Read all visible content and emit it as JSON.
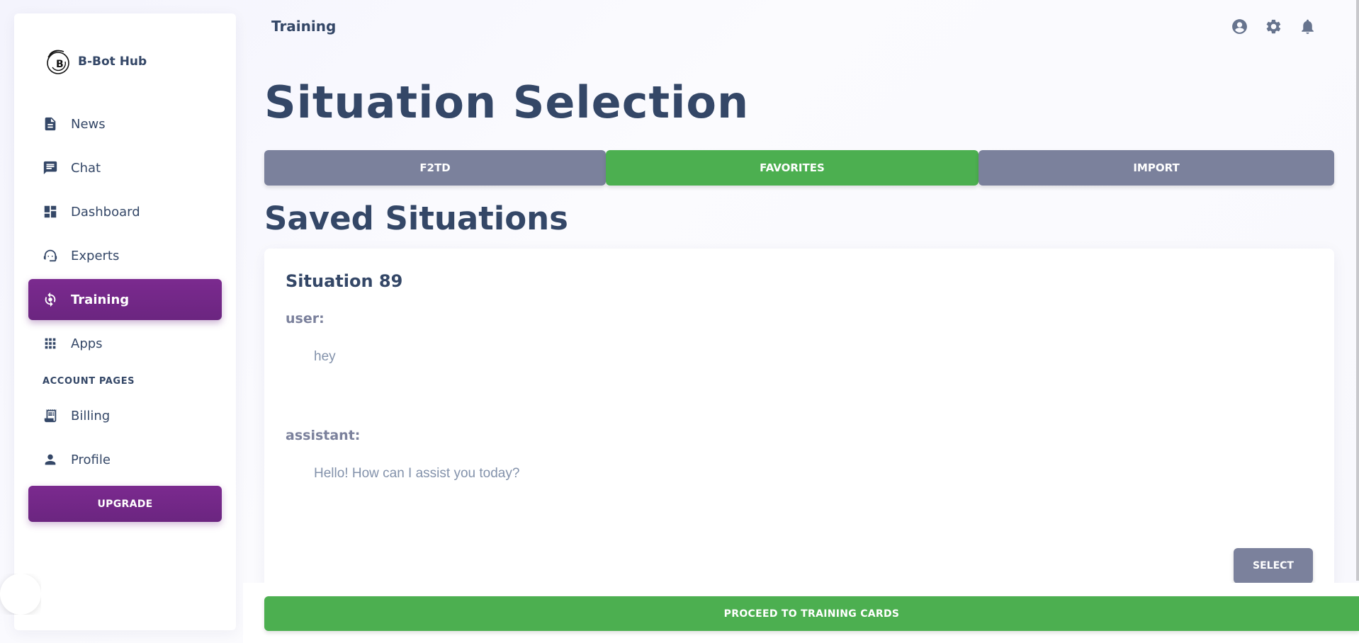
{
  "brand": {
    "name": "B-Bot Hub",
    "logo_icon": "b-bot-swirl-logo"
  },
  "sidebar": {
    "items": [
      {
        "label": "News",
        "icon": "document-icon"
      },
      {
        "label": "Chat",
        "icon": "chat-icon"
      },
      {
        "label": "Dashboard",
        "icon": "dashboard-icon"
      },
      {
        "label": "Experts",
        "icon": "support-agent-icon"
      },
      {
        "label": "Training",
        "icon": "training-icon",
        "active": true
      },
      {
        "label": "Apps",
        "icon": "apps-grid-icon"
      }
    ],
    "section_title": "ACCOUNT PAGES",
    "account_items": [
      {
        "label": "Billing",
        "icon": "receipt-icon"
      },
      {
        "label": "Profile",
        "icon": "person-icon"
      }
    ],
    "upgrade_label": "UPGRADE"
  },
  "header": {
    "breadcrumb": "Training",
    "icons": [
      "account-circle-icon",
      "settings-icon",
      "notifications-icon"
    ]
  },
  "main": {
    "title": "Situation Selection",
    "tabs": [
      {
        "label": "F2TD",
        "active": false
      },
      {
        "label": "FAVORITES",
        "active": true
      },
      {
        "label": "IMPORT",
        "active": false
      }
    ],
    "section_title": "Saved Situations",
    "card": {
      "title": "Situation 89",
      "messages": [
        {
          "role": "user:",
          "text": "hey"
        },
        {
          "role": "assistant:",
          "text": "Hello! How can I assist you today?"
        }
      ],
      "select_label": "SELECT"
    },
    "proceed_label": "PROCEED TO TRAINING CARDS"
  },
  "colors": {
    "primary_text": "#344767",
    "active_purple": "#6b2580",
    "tab_gray": "#7b819c",
    "success_green": "#4caf50"
  }
}
